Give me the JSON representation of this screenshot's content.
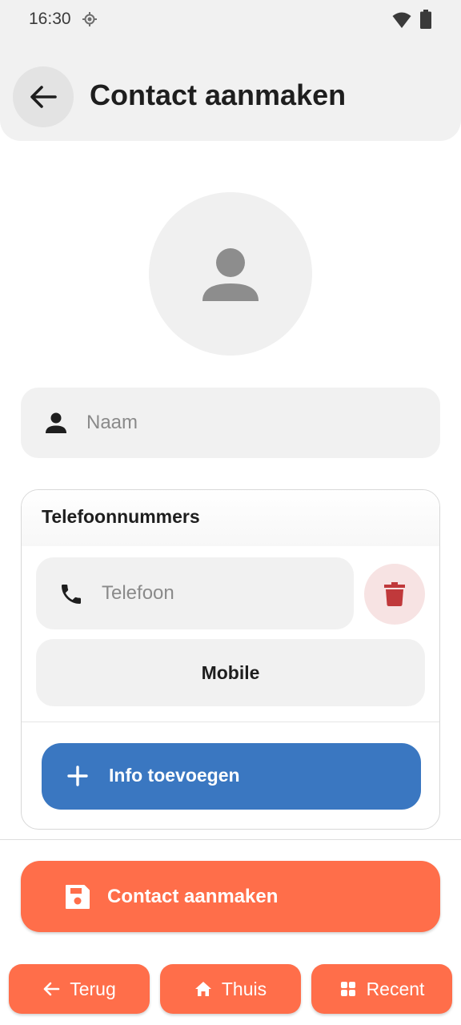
{
  "status_bar": {
    "time": "16:30",
    "icons": [
      "location-icon",
      "wifi-icon",
      "battery-icon"
    ]
  },
  "app_bar": {
    "title": "Contact aanmaken",
    "back_icon": "arrow-left-icon"
  },
  "avatar": {
    "icon": "person-icon"
  },
  "name_field": {
    "placeholder": "Naam",
    "value": "",
    "icon": "person-icon"
  },
  "phones": {
    "title": "Telefoonnummers",
    "entries": [
      {
        "placeholder": "Telefoon",
        "value": "",
        "type": "Mobile",
        "icon": "phone-icon",
        "delete_icon": "trash-icon"
      }
    ],
    "add_label": "Info toevoegen"
  },
  "create_button": {
    "label": "Contact aanmaken",
    "icon": "save-icon"
  },
  "bottom_nav": {
    "back_label": "Terug",
    "home_label": "Thuis",
    "recent_label": "Recent"
  },
  "colors": {
    "accent": "#ff6e4a",
    "primary_blue": "#3a77c1",
    "delete_red": "#c0393b",
    "surface": "#f1f1f1"
  }
}
